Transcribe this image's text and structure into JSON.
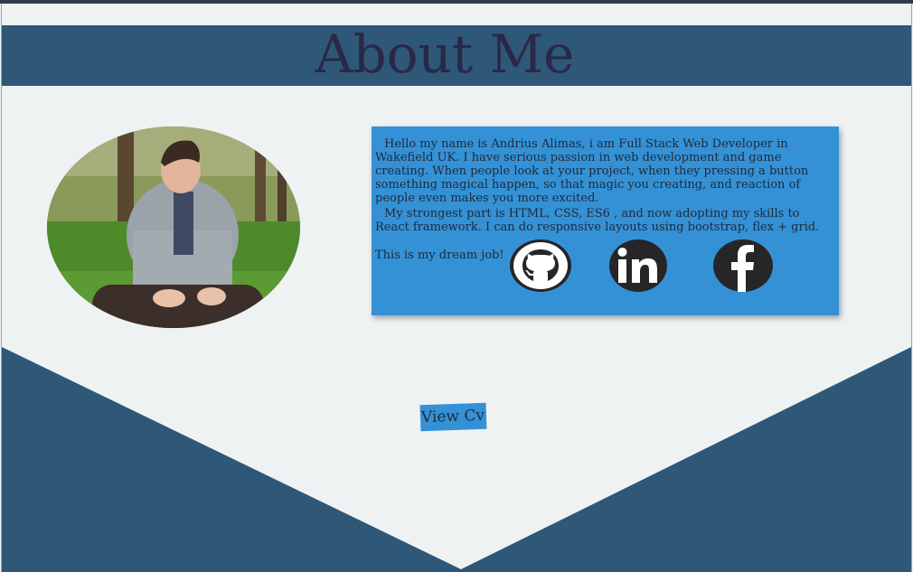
{
  "header": {
    "title": "About Me"
  },
  "bio": {
    "paragraph1": "Hello my name is Andrius Alimas, i am Full Stack Web Developer in Wakefield UK. I have serious passion in web development and game creating. When people look at your project, when they pressing a button something magical happen, so that magic you creating, and reaction of people even makes you more excited.",
    "paragraph2": "My strongest part is HTML, CSS, ES6 , and now adopting my skills to React framework. I can do responsive layouts using bootstrap, flex + grid.",
    "dream": "This is my dream job!"
  },
  "social": [
    {
      "name": "github",
      "icon": "github-icon"
    },
    {
      "name": "linkedin",
      "icon": "linkedin-icon"
    },
    {
      "name": "facebook",
      "icon": "facebook-icon"
    }
  ],
  "cv_button": {
    "label": "View Cv"
  },
  "colors": {
    "background": "#eef2f3",
    "header": "#2f5777",
    "panel": "#3591d6",
    "title_text": "#2a2848",
    "icon_bg": "#262628"
  }
}
